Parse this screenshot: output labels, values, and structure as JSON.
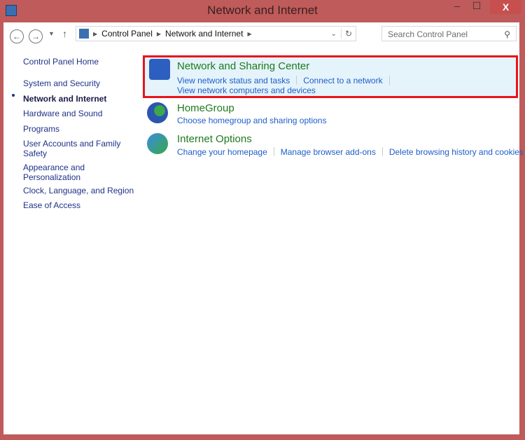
{
  "window": {
    "title": "Network and Internet",
    "min": "–",
    "max": "☐",
    "close": "X"
  },
  "address": {
    "path": [
      "Control Panel",
      "Network and Internet"
    ],
    "search_placeholder": "Search Control Panel"
  },
  "sidebar": {
    "items": [
      {
        "label": "Control Panel Home"
      },
      {
        "label": "System and Security"
      },
      {
        "label": "Network and Internet",
        "active": true
      },
      {
        "label": "Hardware and Sound"
      },
      {
        "label": "Programs"
      },
      {
        "label": "User Accounts and Family Safety"
      },
      {
        "label": "Appearance and Personalization"
      },
      {
        "label": "Clock, Language, and Region"
      },
      {
        "label": "Ease of Access"
      }
    ]
  },
  "categories": [
    {
      "title": "Network and Sharing Center",
      "links": [
        "View network status and tasks",
        "Connect to a network",
        "View network computers and devices"
      ]
    },
    {
      "title": "HomeGroup",
      "links": [
        "Choose homegroup and sharing options"
      ]
    },
    {
      "title": "Internet Options",
      "links": [
        "Change your homepage",
        "Manage browser add-ons",
        "Delete browsing history and cookies"
      ]
    }
  ],
  "colors": {
    "frame": "#bf5b5a",
    "highlight": "#e5f3fb",
    "selection_border": "#e8141c"
  }
}
